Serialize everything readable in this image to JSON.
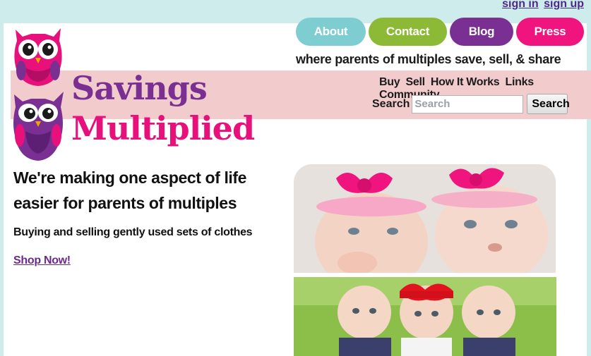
{
  "auth": {
    "sign_in": "sign in",
    "sign_up": "sign up"
  },
  "nav": {
    "about": "About",
    "contact": "Contact",
    "blog": "Blog",
    "press": "Press"
  },
  "tagline": "where parents of multiples save, sell, & share",
  "band": {
    "links": [
      "Buy",
      "Sell",
      "How It Works",
      "Links",
      "Community"
    ],
    "search_label": "Search",
    "search_placeholder": "Search",
    "search_button": "Search"
  },
  "logo": {
    "line1": "Savings",
    "line2": "Multiplied"
  },
  "hero": {
    "headline": "We're making one aspect of life easier for parents of multiples",
    "subtext": "Buying and selling gently used sets of clothes",
    "cta": "Shop Now!"
  },
  "colors": {
    "background": "#cfecec",
    "band": "#f2cccc",
    "about": "#7ecdd1",
    "contact": "#8cba36",
    "blog": "#7a2f92",
    "press": "#f0147f",
    "brand_purple": "#7a2f92",
    "brand_pink": "#e8117c"
  }
}
